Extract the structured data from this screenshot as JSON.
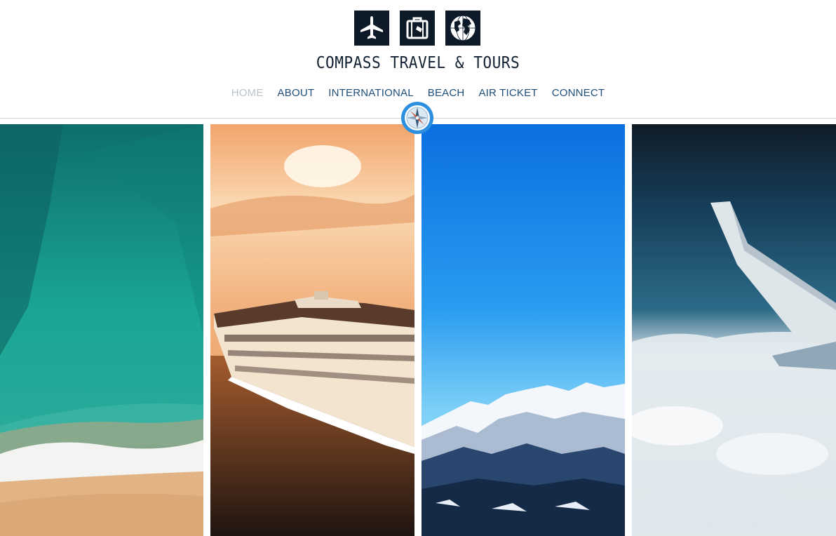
{
  "brand": {
    "name": "COMPASS TRAVEL & TOURS"
  },
  "logo_icons": [
    "airplane-icon",
    "suitcase-icon",
    "globe-icon"
  ],
  "nav": {
    "items": [
      {
        "label": "HOME",
        "active": true
      },
      {
        "label": "ABOUT"
      },
      {
        "label": "INTERNATIONAL"
      },
      {
        "label": "BEACH"
      },
      {
        "label": "AIR TICKET"
      },
      {
        "label": "CONNECT"
      }
    ]
  },
  "panels": [
    {
      "name": "beach-aerial-photo"
    },
    {
      "name": "cruise-ship-photo"
    },
    {
      "name": "snowy-mountains-photo"
    },
    {
      "name": "airplane-wing-clouds-photo"
    }
  ],
  "colors": {
    "brand_text": "#132233",
    "nav_link": "#1f4e7a",
    "nav_active": "#b9c3cc",
    "icon_bg": "#0d1b29",
    "compass_blue": "#2c8fe0"
  }
}
